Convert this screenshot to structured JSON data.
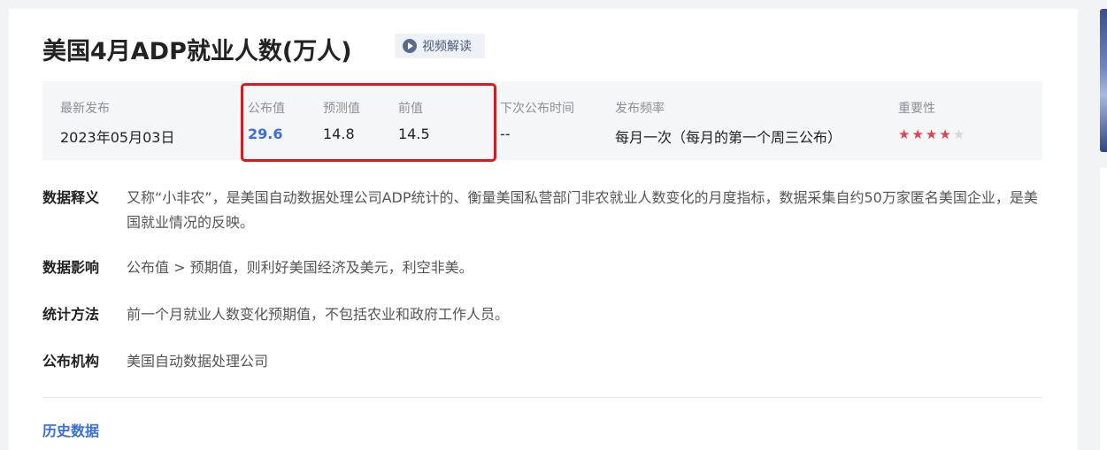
{
  "header": {
    "title": "美国4月ADP就业人数(万人)",
    "video_label": "视频解读"
  },
  "info": {
    "latest_label": "最新发布",
    "latest_value": "2023年05月03日",
    "actual_label": "公布值",
    "actual_value": "29.6",
    "forecast_label": "预测值",
    "forecast_value": "14.8",
    "previous_label": "前值",
    "previous_value": "14.5",
    "next_label": "下次公布时间",
    "next_value": "--",
    "freq_label": "发布频率",
    "freq_value": "每月一次（每月的第一个周三公布）",
    "importance_label": "重要性",
    "importance_stars": 4,
    "importance_max": 5
  },
  "details": [
    {
      "key": "数据释义",
      "value": "又称“小非农”，是美国自动数据处理公司ADP统计的、衡量美国私营部门非农就业人数变化的月度指标，数据采集自约50万家匿名美国企业，是美国就业情况的反映。"
    },
    {
      "key": "数据影响",
      "value": "公布值 > 预期值，则利好美国经济及美元，利空非美。"
    },
    {
      "key": "统计方法",
      "value": "前一个月就业人数变化预期值，不包括农业和政府工作人员。"
    },
    {
      "key": "公布机构",
      "value": "美国自动数据处理公司"
    }
  ],
  "history_label": "历史数据",
  "colors": {
    "accent_blue": "#3a6fd8",
    "highlight_red": "#e3141a",
    "star_red": "#e0424e"
  }
}
